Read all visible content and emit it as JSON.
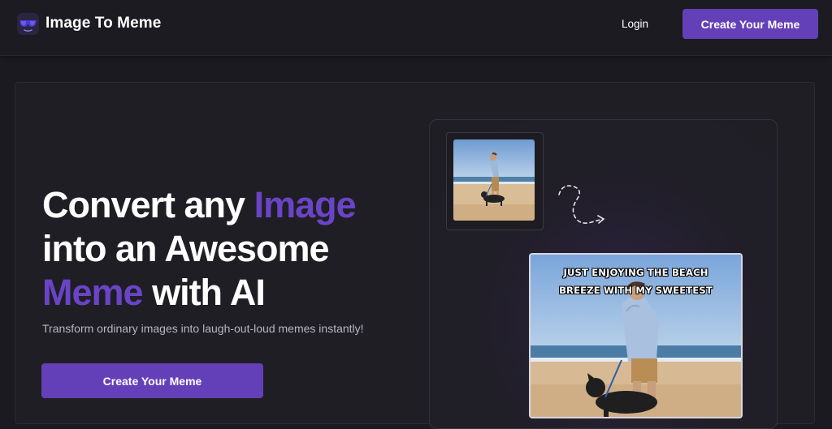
{
  "header": {
    "brand": "Image To Meme",
    "logo_icon": "sunglasses-logo-icon",
    "login_label": "Login",
    "cta_label": "Create Your Meme"
  },
  "hero": {
    "headline_1": "Convert any ",
    "headline_accent_1": "Image",
    "headline_2": "into an Awesome",
    "headline_accent_2": "Meme",
    "headline_3": " with AI",
    "subtitle": "Transform ordinary images into laugh-out-loud memes instantly!",
    "cta_label": "Create Your Meme"
  },
  "illustration": {
    "meme_caption_line1": "JUST ENJOYING THE BEACH",
    "meme_caption_line2": "BREEZE WITH MY SWEETEST",
    "arrow_icon": "dashed-curly-arrow-icon"
  },
  "colors": {
    "accent": "#6440b8",
    "headline_accent": "#6a44c6",
    "background": "#1b1a20",
    "card": "#1f1e24"
  }
}
